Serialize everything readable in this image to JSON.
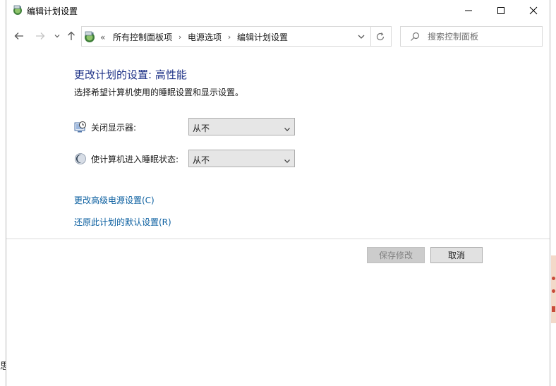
{
  "window": {
    "title": "编辑计划设置"
  },
  "address_bar": {
    "lead": "«",
    "crumbs": [
      "所有控制面板项",
      "电源选项",
      "编辑计划设置"
    ],
    "separator": "›"
  },
  "search": {
    "placeholder": "搜索控制面板"
  },
  "content": {
    "heading": "更改计划的设置: 高性能",
    "subtext": "选择希望计算机使用的睡眠设置和显示设置。",
    "settings": [
      {
        "label": "关闭显示器:",
        "value": "从不",
        "icon": "display-icon"
      },
      {
        "label": "使计算机进入睡眠状态:",
        "value": "从不",
        "icon": "sleep-moon-icon"
      }
    ],
    "links": {
      "advanced": "更改高级电源设置(C)",
      "restore": "还原此计划的默认设置(R)"
    }
  },
  "buttons": {
    "save": "保存修改",
    "cancel": "取消"
  },
  "background": {
    "peek_glyph": "思"
  }
}
